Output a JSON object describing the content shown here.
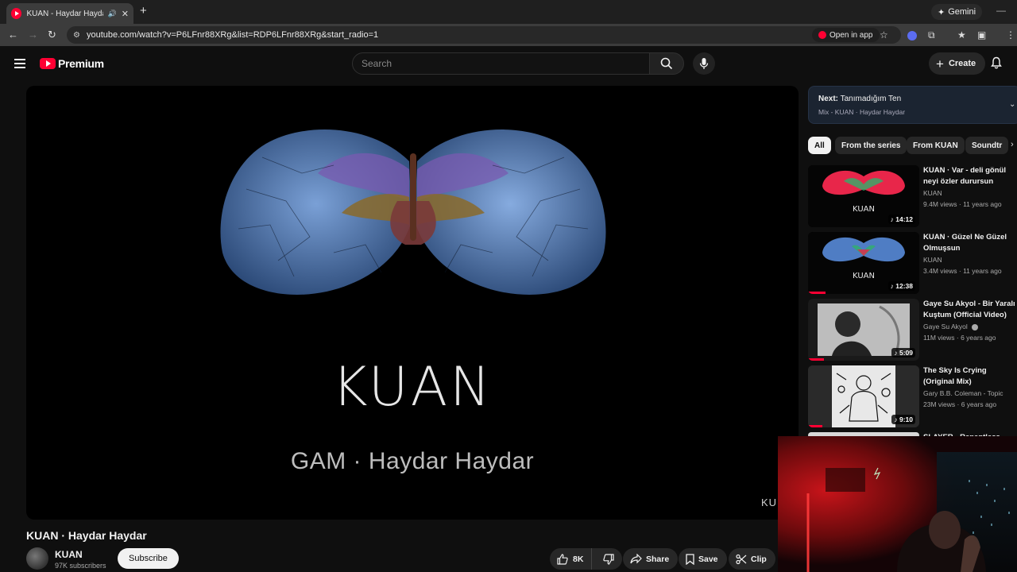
{
  "browser": {
    "tab_title": "KUAN - Haydar Haydar - YouTube",
    "gemini_label": "Gemini",
    "url": "youtube.com/watch?v=P6LFnr88XRg&list=RDP6LFnr88XRg&start_radio=1",
    "open_in_app_label": "Open in app"
  },
  "masthead": {
    "logo_text": "Premium",
    "search_placeholder": "Search",
    "create_label": "Create"
  },
  "player": {
    "artist_text": "KUAN",
    "song_line": "GAM · Haydar Haydar",
    "watermark": "KU"
  },
  "video": {
    "title": "KUAN · Haydar Haydar",
    "channel": "KUAN",
    "subscribers": "97K subscribers",
    "subscribe_label": "Subscribe",
    "likes": "8K",
    "share_label": "Share",
    "save_label": "Save",
    "clip_label": "Clip"
  },
  "up_next": {
    "label": "Next:",
    "title": "Tanımadığım Ten",
    "subtitle": "Mix - KUAN · Haydar Haydar"
  },
  "chips": [
    "All",
    "From the series",
    "From KUAN",
    "Soundtr"
  ],
  "recommendations": [
    {
      "title": "KUAN · Var - deli gönül neyi özler durursun",
      "channel": "KUAN",
      "meta": "9.4M views · 11 years ago",
      "duration": "14:12",
      "thumb_text": "KUAN",
      "verified": false
    },
    {
      "title": "KUAN · Güzel Ne Güzel Olmuşsun",
      "channel": "KUAN",
      "meta": "3.4M views · 11 years ago",
      "duration": "12:38",
      "thumb_text": "KUAN",
      "verified": false
    },
    {
      "title": "Gaye Su Akyol - Bir Yaralı Kuştum (Official Video)",
      "channel": "Gaye Su Akyol",
      "meta": "11M views · 6 years ago",
      "duration": "5:09",
      "thumb_text": "",
      "verified": true
    },
    {
      "title": "The Sky Is Crying (Original Mix)",
      "channel": "Gary B.B. Coleman - Topic",
      "meta": "23M views · 6 years ago",
      "duration": "9:10",
      "thumb_text": "",
      "verified": false
    }
  ],
  "partial_rec_title": "SLAYER - Repentless",
  "colors": {
    "background": "#0f0f0f",
    "accent_red": "#ff0033",
    "chip_active": "#f1f1f1",
    "next_panel": "#1b2431"
  }
}
